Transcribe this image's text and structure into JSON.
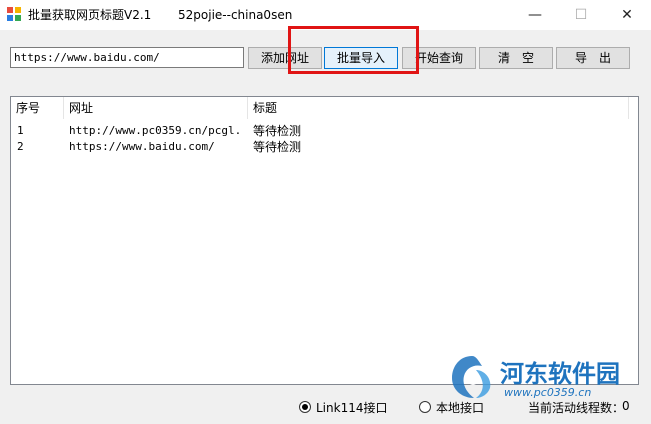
{
  "window": {
    "title": "批量获取网页标题V2.1",
    "subtitle": "52pojie--china0sen",
    "minimize_glyph": "—",
    "maximize_glyph": "☐",
    "close_glyph": "✕"
  },
  "toolbar": {
    "url_value": "https://www.baidu.com/",
    "add_label": "添加网址",
    "import_label": "批量导入",
    "query_label": "开始查询",
    "clear_label": "清　空",
    "export_label": "导　出"
  },
  "list": {
    "columns": [
      "序号",
      "网址",
      "标题"
    ],
    "rows": [
      {
        "index": "1",
        "url": "http://www.pc0359.cn/pcgl...",
        "status": "等待检测"
      },
      {
        "index": "2",
        "url": "https://www.baidu.com/",
        "status": "等待检测"
      }
    ]
  },
  "status": {
    "radio_link114": "Link114接口",
    "radio_local": "本地接口",
    "selected": "link114",
    "thread_label": "当前活动线程数：",
    "thread_count": "0"
  },
  "watermark": {
    "text": "河东软件园",
    "url": "www.pc0359.cn"
  },
  "colors": {
    "highlight": "#e01414",
    "accent": "#0078d7",
    "watermark": "#1e73be"
  },
  "icons": {
    "app": "app-window-icon",
    "watermark_logo": "hedong-logo-icon"
  }
}
